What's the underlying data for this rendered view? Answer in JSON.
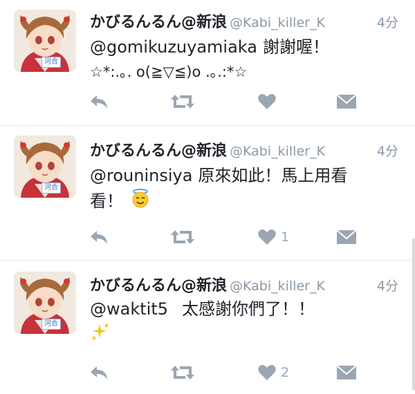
{
  "tweets": [
    {
      "name": "かびるんるん@新浪",
      "handle": "@Kabi_killer_K",
      "time": "4分",
      "mention": "@gomikuzuyamiaka",
      "body": "謝謝喔！",
      "line2": "☆*:.｡. o(≧▽≦)o .｡.:*☆",
      "emoji": "",
      "like_count": ""
    },
    {
      "name": "かびるんるん@新浪",
      "handle": "@Kabi_killer_K",
      "time": "4分",
      "mention": "@rouninsiya",
      "body": "原來如此！馬上用看",
      "line2": "看！",
      "emoji": "smiling-face-with-halo-icon",
      "like_count": "1"
    },
    {
      "name": "かびるんるん@新浪",
      "handle": "@Kabi_killer_K",
      "time": "4分",
      "mention": "@waktit5",
      "body": "太感謝你們了！！",
      "line2": "",
      "emoji": "sparkles-icon",
      "like_count": "2"
    }
  ],
  "avatar_tag": "河合",
  "colors": {
    "text": "#1f2329",
    "muted": "#8b98a5",
    "icon": "#9aa6b2",
    "divider": "#e1e8ed"
  }
}
